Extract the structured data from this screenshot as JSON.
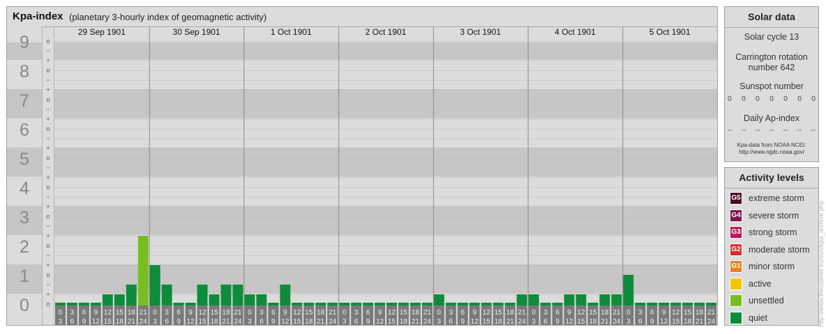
{
  "header": {
    "title": "Kpa-index",
    "subtitle": "(planetary 3-hourly index of geomagnetic activity)"
  },
  "chart_data": {
    "type": "bar",
    "title": "Kpa-index",
    "subtitle": "(planetary 3-hourly index of geomagnetic activity)",
    "ylim": [
      0,
      9
    ],
    "y_ticks": [
      "0",
      "1",
      "2",
      "3",
      "4",
      "5",
      "6",
      "7",
      "8",
      "9"
    ],
    "sub_ticks": [
      "o",
      "+",
      "−"
    ],
    "days": [
      "29 Sep 1901",
      "30 Sep 1901",
      "1 Oct 1901",
      "2 Oct 1901",
      "3 Oct 1901",
      "4 Oct 1901",
      "5 Oct 1901"
    ],
    "interval_start": [
      "0",
      "3",
      "6",
      "9",
      "12",
      "15",
      "18",
      "21"
    ],
    "interval_end": [
      "3",
      "6",
      "9",
      "12",
      "15",
      "18",
      "21",
      "24"
    ],
    "values": [
      [
        0,
        0,
        0,
        0,
        0.333,
        0.333,
        0.667,
        2.333
      ],
      [
        1.333,
        0.667,
        0,
        0,
        0.667,
        0.333,
        0.667,
        0.667
      ],
      [
        0.333,
        0.333,
        0,
        0.667,
        0,
        0,
        0,
        0
      ],
      [
        0,
        0,
        0,
        0,
        0,
        0,
        0,
        0
      ],
      [
        0.333,
        0,
        0,
        0,
        0,
        0,
        0,
        0.333
      ],
      [
        0.333,
        0,
        0,
        0.333,
        0.333,
        0,
        0.333,
        0.333
      ],
      [
        1,
        0,
        0,
        0,
        0,
        0,
        0,
        0
      ]
    ],
    "grid": true,
    "colors": {
      "quiet": "#0e8c3c",
      "unsettled": "#78be21",
      "band_dark": "#c6c6c6",
      "band_light": "#dcdcdc",
      "axis_number": "#888888",
      "tick_box": "#7a7a7a"
    }
  },
  "solar": {
    "title": "Solar data",
    "cycle": "Solar cycle 13",
    "carrington_line1": "Carrington rotation",
    "carrington_line2": "number 642",
    "sunspot_label": "Sunspot number",
    "sunspot_values": [
      "0",
      "0",
      "0",
      "0",
      "0",
      "0",
      "0"
    ],
    "ap_label": "Daily Ap-index",
    "ap_values": [
      "--",
      "--",
      "--",
      "--",
      "--",
      "--",
      "--"
    ],
    "source_line1": "Kpa-data from NOAA NCEI:",
    "source_line2": "http://www.ngdc.noaa.gov/"
  },
  "activity": {
    "title": "Activity levels",
    "levels": [
      {
        "code": "G5",
        "label": "extreme storm",
        "color": "#4a0a2a"
      },
      {
        "code": "G4",
        "label": "severe storm",
        "color": "#7b1450"
      },
      {
        "code": "G3",
        "label": "strong storm",
        "color": "#b8195a"
      },
      {
        "code": "G2",
        "label": "moderate storm",
        "color": "#d0322a"
      },
      {
        "code": "G1",
        "label": "minor storm",
        "color": "#e8821e"
      },
      {
        "code": "",
        "label": "active",
        "color": "#f5c400"
      },
      {
        "code": "",
        "label": "unsettled",
        "color": "#78be21"
      },
      {
        "code": "",
        "label": "quiet",
        "color": "#0e8c3c"
      }
    ]
  },
  "credit": "http://www.theusenet.eu/sun/kpa_archive.php"
}
